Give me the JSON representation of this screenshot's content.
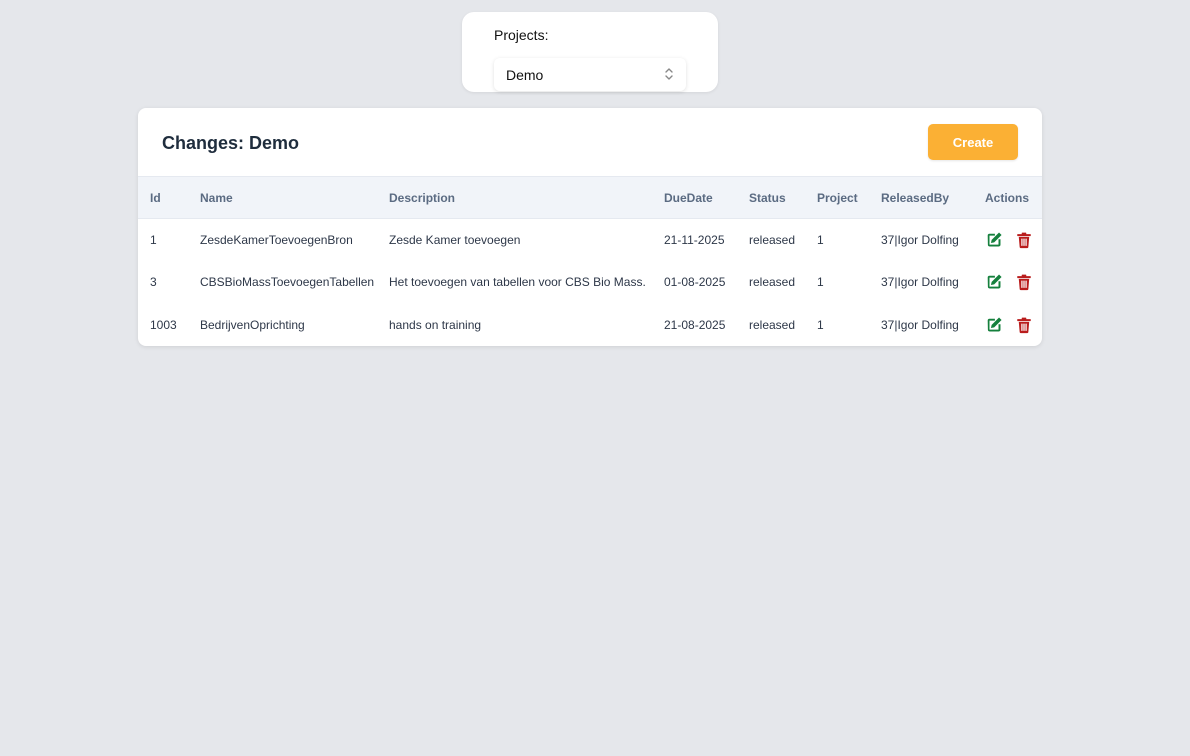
{
  "projects": {
    "label": "Projects:",
    "selected": "Demo"
  },
  "changes": {
    "title": "Changes: Demo",
    "create_label": "Create",
    "columns": [
      "Id",
      "Name",
      "Description",
      "DueDate",
      "Status",
      "Project",
      "ReleasedBy",
      "Actions"
    ],
    "rows": [
      {
        "id": "1",
        "name": "ZesdeKamerToevoegenBron",
        "description": "Zesde Kamer toevoegen",
        "due_date": "21-11-2025",
        "status": "released",
        "project": "1",
        "released_by": "37|Igor Dolfing"
      },
      {
        "id": "3",
        "name": "CBSBioMassToevoegenTabellen",
        "description": "Het toevoegen van tabellen voor CBS Bio Mass.",
        "due_date": "01-08-2025",
        "status": "released",
        "project": "1",
        "released_by": "37|Igor Dolfing"
      },
      {
        "id": "1003",
        "name": "BedrijvenOprichting",
        "description": "hands on training",
        "due_date": "21-08-2025",
        "status": "released",
        "project": "1",
        "released_by": "37|Igor Dolfing"
      }
    ]
  },
  "icons": {
    "edit": "edit-icon",
    "delete": "trash-icon",
    "select": "chevron-up-down-icon"
  },
  "colors": {
    "accent": "#fbb034",
    "edit": "#15803d",
    "delete": "#b91c1c",
    "background": "#e5e7eb"
  }
}
